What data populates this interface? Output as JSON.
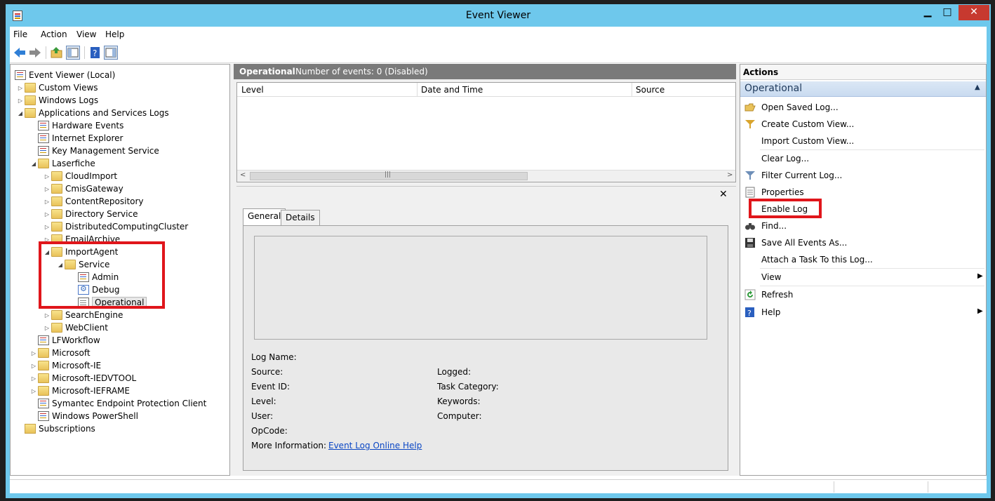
{
  "window": {
    "title": "Event Viewer"
  },
  "menu": {
    "items": [
      "File",
      "Action",
      "View",
      "Help"
    ]
  },
  "tree": {
    "items": [
      {
        "label": "Event Viewer (Local)"
      },
      {
        "label": "Custom Views"
      },
      {
        "label": "Windows Logs"
      },
      {
        "label": "Applications and Services Logs"
      },
      {
        "label": "Hardware Events"
      },
      {
        "label": "Internet Explorer"
      },
      {
        "label": "Key Management Service"
      },
      {
        "label": "Laserfiche"
      },
      {
        "label": "CloudImport"
      },
      {
        "label": "CmisGateway"
      },
      {
        "label": "ContentRepository"
      },
      {
        "label": "Directory Service"
      },
      {
        "label": "DistributedComputingCluster"
      },
      {
        "label": "EmailArchive"
      },
      {
        "label": "ImportAgent"
      },
      {
        "label": "Service"
      },
      {
        "label": "Admin"
      },
      {
        "label": "Debug"
      },
      {
        "label": "Operational"
      },
      {
        "label": "SearchEngine"
      },
      {
        "label": "WebClient"
      },
      {
        "label": "LFWorkflow"
      },
      {
        "label": "Microsoft"
      },
      {
        "label": "Microsoft-IE"
      },
      {
        "label": "Microsoft-IEDVTOOL"
      },
      {
        "label": "Microsoft-IEFRAME"
      },
      {
        "label": "Symantec Endpoint Protection Client"
      },
      {
        "label": "Windows PowerShell"
      },
      {
        "label": "Subscriptions"
      }
    ]
  },
  "center": {
    "log_name": "Operational",
    "event_count": "Number of events: 0 (Disabled)",
    "columns": [
      "Level",
      "Date and Time",
      "Source"
    ],
    "tabs": [
      "General",
      "Details"
    ],
    "fields_left": [
      "Log Name:",
      "Source:",
      "Event ID:",
      "Level:",
      "User:",
      "OpCode:",
      "More Information:"
    ],
    "fields_right": [
      "Logged:",
      "Task Category:",
      "Keywords:",
      "Computer:"
    ],
    "help_link": "Event Log Online Help"
  },
  "actions": {
    "title": "Actions",
    "section": "Operational",
    "items": [
      {
        "label": "Open Saved Log...",
        "icon": "open-folder-icon"
      },
      {
        "label": "Create Custom View...",
        "icon": "funnel-icon"
      },
      {
        "label": "Import Custom View...",
        "icon": ""
      },
      {
        "label": "Clear Log...",
        "icon": ""
      },
      {
        "label": "Filter Current Log...",
        "icon": "filter-icon"
      },
      {
        "label": "Properties",
        "icon": "properties-icon"
      },
      {
        "label": "Enable Log",
        "icon": ""
      },
      {
        "label": "Find...",
        "icon": "binoculars-icon"
      },
      {
        "label": "Save All Events As...",
        "icon": "save-icon"
      },
      {
        "label": "Attach a Task To this Log...",
        "icon": ""
      },
      {
        "label": "View",
        "icon": ""
      },
      {
        "label": "Refresh",
        "icon": "refresh-icon"
      },
      {
        "label": "Help",
        "icon": "help-icon"
      }
    ]
  },
  "colors": {
    "titlebar": "#6ec8ec",
    "highlight": "#e0161b",
    "close": "#c7392f",
    "link": "#0a46c4"
  }
}
